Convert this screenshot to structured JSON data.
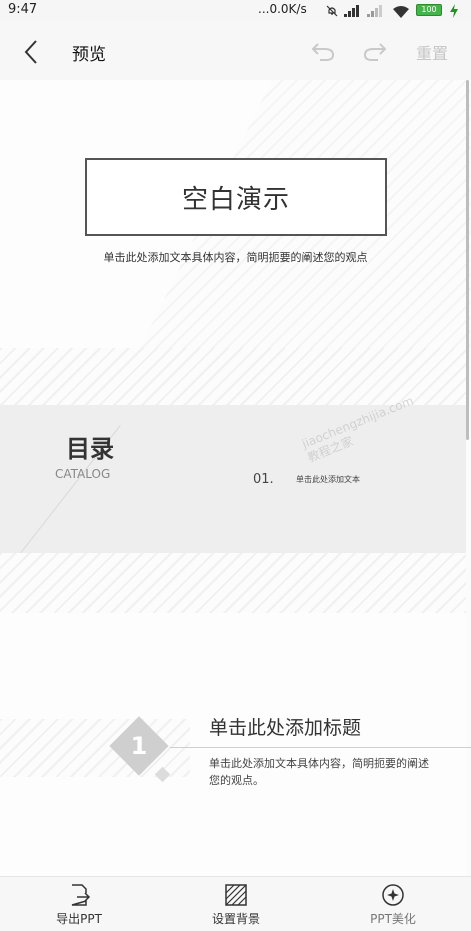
{
  "status_bar": {
    "time": "9:47",
    "network_speed": "...0.0K/s",
    "battery": "100"
  },
  "header": {
    "title": "预览",
    "reset_label": "重置"
  },
  "slides": {
    "cover": {
      "title": "空白演示",
      "subtitle": "单击此处添加文本具体内容，简明扼要的阐述您的观点"
    },
    "contents": {
      "heading": "目录",
      "subheading": "CATALOG",
      "item_number": "01.",
      "item_text": "单击此处添加文本"
    },
    "section": {
      "number": "1",
      "title": "单击此处添加标题",
      "body": "单击此处添加文本具体内容，简明扼要的阐述您的观点。"
    }
  },
  "watermark": {
    "line1": "jiaochengzhijia.com",
    "line2": "教程之家"
  },
  "toolbar": {
    "export_label": "导出PPT",
    "background_label": "设置背景",
    "beautify_label": "PPT美化"
  },
  "icons": {
    "back": "chevron-left-icon",
    "undo": "undo-icon",
    "redo": "redo-icon",
    "export": "export-file-icon",
    "background": "hatched-square-icon",
    "beautify": "sparkle-circle-icon"
  }
}
